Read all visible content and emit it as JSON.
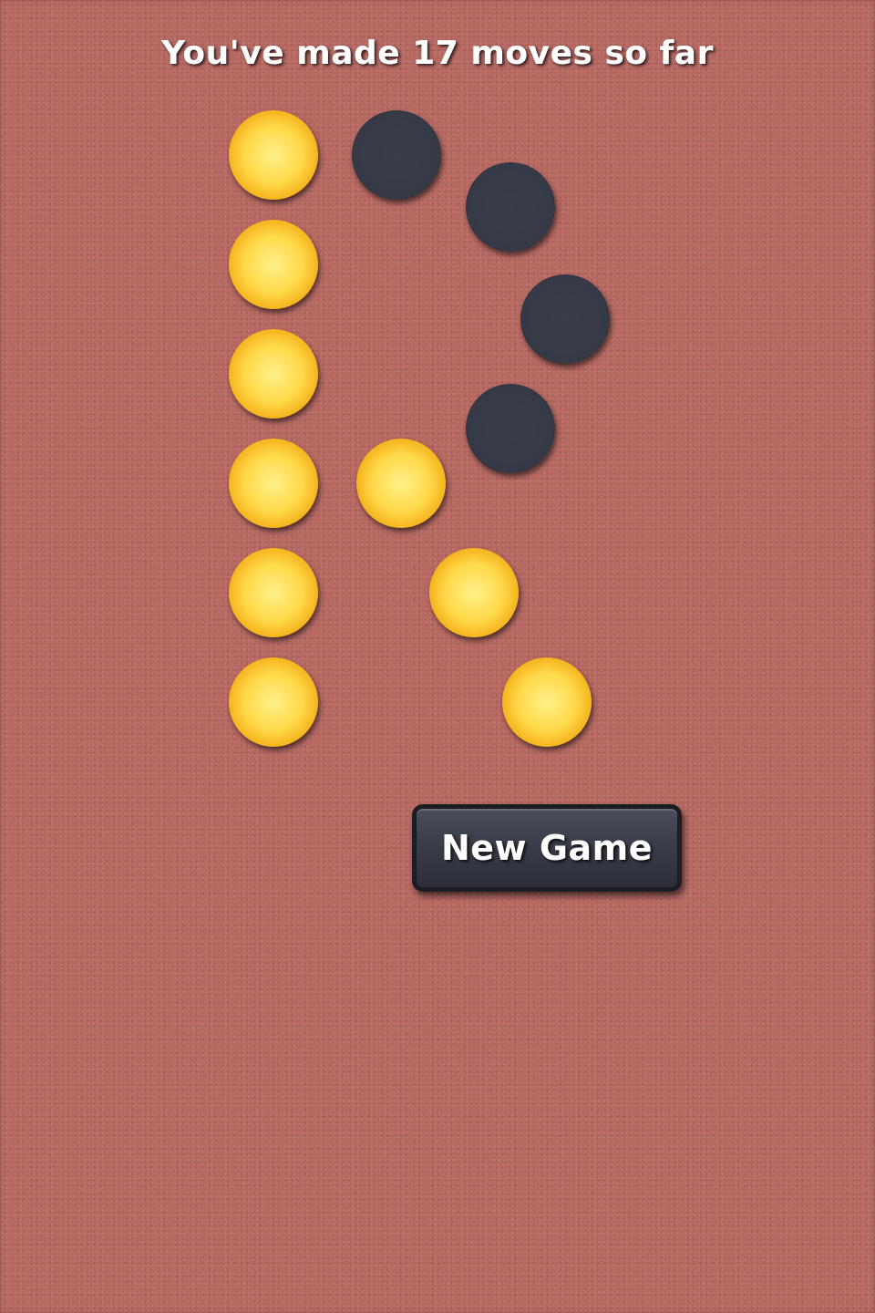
{
  "status": {
    "moves_text": "You've made 17 moves so far"
  },
  "buttons": {
    "new_game_label": "New Game"
  },
  "pegs": [
    {
      "state": "yellow"
    },
    {
      "state": "dark"
    },
    {
      "state": "dark"
    },
    {
      "state": "yellow"
    },
    {
      "state": "dark"
    },
    {
      "state": "yellow"
    },
    {
      "state": "dark"
    },
    {
      "state": "yellow"
    },
    {
      "state": "yellow"
    },
    {
      "state": "yellow"
    },
    {
      "state": "yellow"
    },
    {
      "state": "yellow"
    },
    {
      "state": "yellow"
    }
  ],
  "colors": {
    "background": "#b4635b",
    "peg_lit": "#ffd94a",
    "peg_empty": "#363946",
    "button": "#3a3d4a"
  }
}
